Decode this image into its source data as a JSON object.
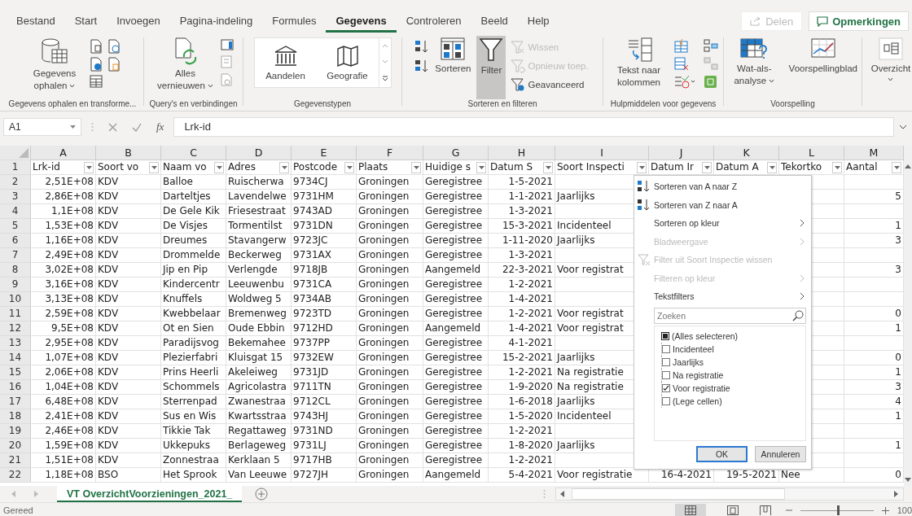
{
  "tabs": [
    {
      "label": "Bestand",
      "selected": false
    },
    {
      "label": "Start",
      "selected": false
    },
    {
      "label": "Invoegen",
      "selected": false
    },
    {
      "label": "Pagina-indeling",
      "selected": false
    },
    {
      "label": "Formules",
      "selected": false
    },
    {
      "label": "Gegevens",
      "selected": true
    },
    {
      "label": "Controleren",
      "selected": false
    },
    {
      "label": "Beeld",
      "selected": false
    },
    {
      "label": "Help",
      "selected": false
    }
  ],
  "share_button": {
    "label": "Delen",
    "disabled": true
  },
  "comments_button": {
    "label": "Opmerkingen"
  },
  "ribbon": {
    "groups": [
      {
        "label": "Gegevens ophalen en transforme...",
        "buttons": [
          {
            "label": "Gegevens ophalen",
            "dropdown": true
          }
        ]
      },
      {
        "label": "Query's en verbindingen",
        "buttons": [
          {
            "label": "Alles vernieuwen",
            "dropdown": true
          }
        ]
      },
      {
        "label": "Gegevenstypen",
        "buttons": [
          {
            "label": "Aandelen"
          },
          {
            "label": "Geografie"
          }
        ]
      },
      {
        "label": "Sorteren en filteren",
        "buttons": [
          {
            "label": "Sorteren",
            "selected": false,
            "disabled": false
          },
          {
            "label": "Filter",
            "selected": true,
            "disabled": false
          },
          {
            "label": "Wissen",
            "selected": false,
            "disabled": true
          },
          {
            "label": "Opnieuw toep.",
            "selected": false,
            "disabled": true
          },
          {
            "label": "Geavanceerd",
            "selected": false,
            "disabled": false
          }
        ]
      },
      {
        "label": "Hulpmiddelen voor gegevens",
        "buttons": [
          {
            "label": "Tekst naar kolommen",
            "dropdown": false
          }
        ]
      },
      {
        "label": "Voorspelling",
        "buttons": [
          {
            "label": "Wat-als-analyse",
            "dropdown": true
          },
          {
            "label": "Voorspellingblad",
            "dropdown": false
          }
        ]
      },
      {
        "buttons": [
          {
            "label": "Overzicht",
            "dropdown": true
          }
        ]
      }
    ]
  },
  "formula_bar": {
    "name_box": "A1",
    "function_label": "fx",
    "formula": "Lrk-id"
  },
  "sheet": {
    "column_letters": [
      "A",
      "B",
      "C",
      "D",
      "E",
      "F",
      "G",
      "H",
      "I",
      "J",
      "K",
      "L",
      "M"
    ],
    "header_row": {
      "number": "1",
      "cells": [
        "Lrk-id",
        "Soort vo",
        "Naam vo",
        "Adres",
        "Postcode",
        "Plaats",
        "Huidige s",
        "Datum S",
        "Soort Inspecti",
        "Datum Ir",
        "Datum A",
        "Tekortko",
        "Aantal"
      ]
    },
    "rows": [
      {
        "number": "2",
        "cells": [
          "2,51E+08",
          "KDV",
          "Balloe",
          "Ruischerwa",
          "9734CJ",
          "Groningen",
          "Geregistree",
          "1-5-2021"
        ]
      },
      {
        "number": "3",
        "cells": [
          "2,86E+08",
          "KDV",
          "Darteltjes",
          "Lavendelwe",
          "9731HM",
          "Groningen",
          "Geregistree",
          "1-1-2021",
          "Jaarlijks"
        ],
        "aantal": "5"
      },
      {
        "number": "4",
        "cells": [
          "1,1E+08",
          "KDV",
          "De Gele Kik",
          "Friesestraat",
          "9743AD",
          "Groningen",
          "Geregistree",
          "1-3-2021"
        ]
      },
      {
        "number": "5",
        "cells": [
          "1,53E+08",
          "KDV",
          "De Visjes",
          "Tormentilst",
          "9731DN",
          "Groningen",
          "Geregistree",
          "15-3-2021",
          "Incidenteel"
        ],
        "aantal": "1"
      },
      {
        "number": "6",
        "cells": [
          "1,16E+08",
          "KDV",
          "Dreumes",
          "Stavangerw",
          "9723JC",
          "Groningen",
          "Geregistree",
          "1-11-2020",
          "Jaarlijks"
        ],
        "aantal": "3"
      },
      {
        "number": "7",
        "cells": [
          "2,49E+08",
          "KDV",
          "Drommelde",
          "Beckerweg",
          "9731AX",
          "Groningen",
          "Geregistree",
          "1-3-2021"
        ]
      },
      {
        "number": "8",
        "cells": [
          "3,02E+08",
          "KDV",
          "Jip en Pip",
          "Verlengde",
          "9718JB",
          "Groningen",
          "Aangemeld",
          "22-3-2021",
          "Voor registrat"
        ],
        "aantal": "3"
      },
      {
        "number": "9",
        "cells": [
          "3,16E+08",
          "KDV",
          "Kindercentr",
          "Leeuwenbu",
          "9731CA",
          "Groningen",
          "Geregistree",
          "1-2-2021"
        ]
      },
      {
        "number": "10",
        "cells": [
          "3,13E+08",
          "KDV",
          "Knuffels",
          "Woldweg 5",
          "9734AB",
          "Groningen",
          "Geregistree",
          "1-4-2021"
        ]
      },
      {
        "number": "11",
        "cells": [
          "2,59E+08",
          "KDV",
          "Kwebbelaar",
          "Bremenweg",
          "9723TD",
          "Groningen",
          "Geregistree",
          "1-2-2021",
          "Voor registrat"
        ],
        "aantal": "0"
      },
      {
        "number": "12",
        "cells": [
          "9,5E+08",
          "KDV",
          "Ot en Sien",
          "Oude Ebbin",
          "9712HD",
          "Groningen",
          "Aangemeld",
          "1-4-2021",
          "Voor registrat"
        ],
        "aantal": "1"
      },
      {
        "number": "13",
        "cells": [
          "2,95E+08",
          "KDV",
          "Paradijsvog",
          "Bekemahee",
          "9737PP",
          "Groningen",
          "Geregistree",
          "4-1-2021"
        ]
      },
      {
        "number": "14",
        "cells": [
          "1,07E+08",
          "KDV",
          "Plezierfabri",
          "Kluisgat 15",
          "9732EW",
          "Groningen",
          "Geregistree",
          "15-2-2021",
          "Jaarlijks"
        ],
        "aantal": "0"
      },
      {
        "number": "15",
        "cells": [
          "2,06E+08",
          "KDV",
          "Prins Heerli",
          "Akeleiweg",
          "9731JD",
          "Groningen",
          "Geregistree",
          "1-2-2021",
          "Na registratie"
        ],
        "aantal": "1"
      },
      {
        "number": "16",
        "cells": [
          "1,04E+08",
          "KDV",
          "Schommels",
          "Agricolastra",
          "9711TN",
          "Groningen",
          "Geregistree",
          "1-9-2020",
          "Na registratie"
        ],
        "aantal": "3"
      },
      {
        "number": "17",
        "cells": [
          "6,48E+08",
          "KDV",
          "Sterrenpad",
          "Zwanestraa",
          "9712CL",
          "Groningen",
          "Geregistree",
          "1-6-2018",
          "Jaarlijks"
        ],
        "aantal": "4"
      },
      {
        "number": "18",
        "cells": [
          "2,41E+08",
          "KDV",
          "Sus en Wis",
          "Kwartsstraa",
          "9743HJ",
          "Groningen",
          "Geregistree",
          "1-5-2020",
          "Incidenteel"
        ],
        "aantal": "1"
      },
      {
        "number": "19",
        "cells": [
          "2,46E+08",
          "KDV",
          "Tikkie Tak",
          "Regattaweg",
          "9731ND",
          "Groningen",
          "Geregistree",
          "1-2-2021"
        ]
      },
      {
        "number": "20",
        "cells": [
          "1,59E+08",
          "KDV",
          "Ukkepuks",
          "Berlageweg",
          "9731LJ",
          "Groningen",
          "Geregistree",
          "1-8-2020",
          "Jaarlijks"
        ],
        "aantal": "1"
      },
      {
        "number": "21",
        "cells": [
          "1,51E+08",
          "KDV",
          "Zonnestraa",
          "Kerklaan 5",
          "9717HB",
          "Groningen",
          "Geregistree",
          "1-2-2021"
        ]
      },
      {
        "number": "22",
        "cells": [
          "1,18E+08",
          "BSO",
          "Het Sprook",
          "Van Leeuwe",
          "9727JH",
          "Groningen",
          "Aangemeld",
          "5-4-2021",
          "Voor registratie",
          "16-4-2021",
          "19-5-2021",
          "Nee"
        ],
        "aantal": "0"
      }
    ]
  },
  "filter_menu": {
    "items": [
      {
        "label": "Sorteren van A naar Z",
        "kind": "sort-asc",
        "disabled": false,
        "submenu": false
      },
      {
        "label": "Sorteren van Z naar A",
        "kind": "sort-desc",
        "disabled": false,
        "submenu": false
      },
      {
        "label": "Sorteren op kleur",
        "kind": "plain",
        "disabled": false,
        "submenu": true
      },
      {
        "label": "Bladweergave",
        "kind": "plain",
        "disabled": true,
        "submenu": true
      },
      {
        "label": "Filter uit Soort Inspectie wissen",
        "kind": "clear-filter",
        "disabled": true,
        "submenu": false
      },
      {
        "label": "Filteren op kleur",
        "kind": "plain",
        "disabled": true,
        "submenu": true
      },
      {
        "label": "Tekstfilters",
        "kind": "plain",
        "disabled": false,
        "submenu": true
      }
    ],
    "search": {
      "placeholder": "Zoeken"
    },
    "values": [
      {
        "label": "(Alles selecteren)",
        "checked": false,
        "mixed": true
      },
      {
        "label": "Incidenteel",
        "checked": false,
        "mixed": false
      },
      {
        "label": "Jaarlijks",
        "checked": false,
        "mixed": false
      },
      {
        "label": "Na registratie",
        "checked": false,
        "mixed": false
      },
      {
        "label": "Voor registratie",
        "checked": true,
        "mixed": false
      },
      {
        "label": "(Lege cellen)",
        "checked": false,
        "mixed": false
      }
    ],
    "buttons": [
      {
        "label": "OK",
        "default": true
      },
      {
        "label": "Annuleren",
        "default": false
      }
    ]
  },
  "sheet_tabs": [
    {
      "label": "VT OverzichtVoorzieningen_2021_",
      "selected": true
    }
  ],
  "status_bar": {
    "status": "Gereed",
    "zoom": "100",
    "zoom_slider": {
      "level": 0.5
    }
  }
}
